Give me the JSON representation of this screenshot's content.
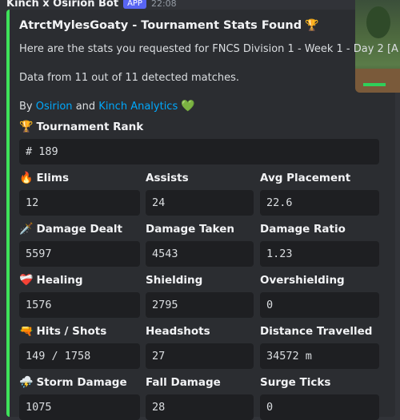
{
  "header": {
    "bot_name": "Kinch x Osirion Bot",
    "tag": "APP",
    "time": "22:08"
  },
  "embed": {
    "title": "AtrctMylesGoaty - Tournament Stats Found",
    "title_icon": "trophy-icon",
    "description_line": "Here are the stats you requested for FNCS Division 1 - Week 1 - Day 2 [A",
    "data_line": "Data from 11 out of 11 detected matches.",
    "credit_prefix": "By",
    "credit_osirion": "Osirion",
    "credit_and": "and",
    "credit_kinch": "Kinch Analytics",
    "credit_icon": "green-heart-icon",
    "rank_label": "Tournament Rank",
    "rank_value": "# 189",
    "fields": {
      "elims": {
        "label": "Elims",
        "value": "12"
      },
      "assists": {
        "label": "Assists",
        "value": "24"
      },
      "avg_placement": {
        "label": "Avg Placement",
        "value": "22.6"
      },
      "damage_dealt": {
        "label": "Damage Dealt",
        "value": "5597"
      },
      "damage_taken": {
        "label": "Damage Taken",
        "value": "4543"
      },
      "damage_ratio": {
        "label": "Damage Ratio",
        "value": "1.23"
      },
      "healing": {
        "label": "Healing",
        "value": "1576"
      },
      "shielding": {
        "label": "Shielding",
        "value": "2795"
      },
      "overshielding": {
        "label": "Overshielding",
        "value": "0"
      },
      "hits_shots": {
        "label": "Hits / Shots",
        "value": "149 / 1758"
      },
      "headshots": {
        "label": "Headshots",
        "value": "27"
      },
      "distance": {
        "label": "Distance Travelled",
        "value": "34572 m"
      },
      "storm_damage": {
        "label": "Storm Damage",
        "value": "1075"
      },
      "fall_damage": {
        "label": "Fall Damage",
        "value": "28"
      },
      "surge_ticks": {
        "label": "Surge Ticks",
        "value": "0"
      }
    }
  },
  "colors": {
    "accent_bar": "#3ee25a",
    "link": "#00a8fc",
    "embed_bg": "#2b2d31",
    "field_bg": "#1e1f22"
  }
}
